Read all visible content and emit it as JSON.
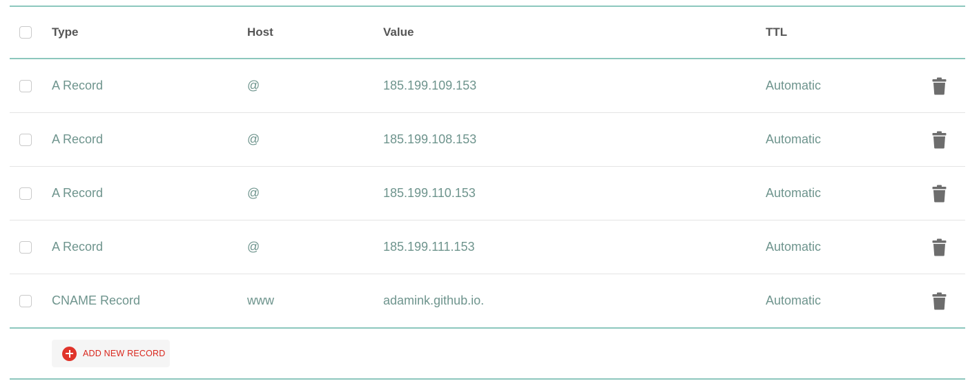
{
  "table": {
    "headers": {
      "type": "Type",
      "host": "Host",
      "value": "Value",
      "ttl": "TTL"
    },
    "rows": [
      {
        "type": "A Record",
        "host": "@",
        "value": "185.199.109.153",
        "ttl": "Automatic"
      },
      {
        "type": "A Record",
        "host": "@",
        "value": "185.199.108.153",
        "ttl": "Automatic"
      },
      {
        "type": "A Record",
        "host": "@",
        "value": "185.199.110.153",
        "ttl": "Automatic"
      },
      {
        "type": "A Record",
        "host": "@",
        "value": "185.199.111.153",
        "ttl": "Automatic"
      },
      {
        "type": "CNAME Record",
        "host": "www",
        "value": "adamink.github.io.",
        "ttl": "Automatic"
      }
    ]
  },
  "footer": {
    "add_button_label": "ADD NEW RECORD"
  },
  "colors": {
    "accent_rule": "#8cc7bd",
    "row_text": "#6e948d",
    "add_button_red": "#e0342b"
  },
  "icons": {
    "delete": "trash-icon",
    "add": "plus-circle-icon"
  }
}
